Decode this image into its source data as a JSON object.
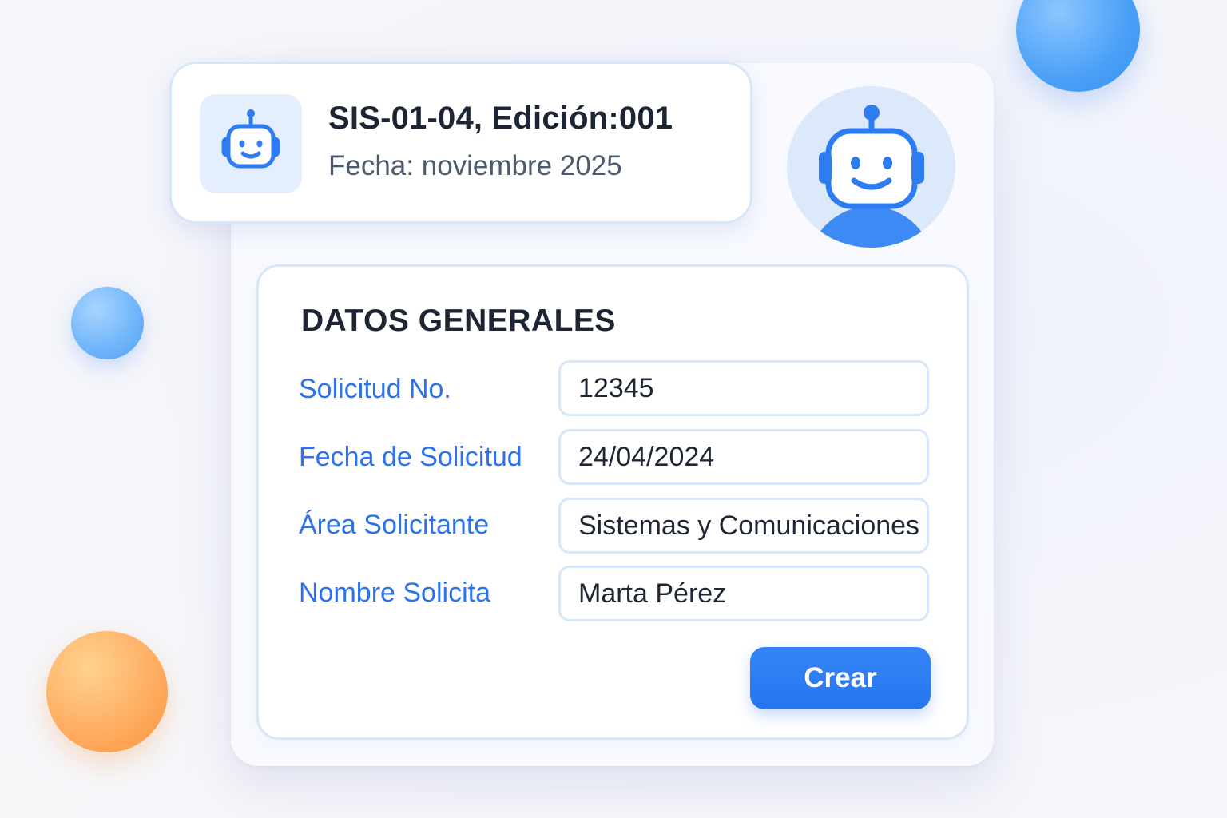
{
  "header": {
    "title": "SIS-01-04, Edición:001",
    "date": "Fecha: noviembre 2025",
    "icon": "robot-icon"
  },
  "avatar": {
    "icon": "robot-avatar-icon"
  },
  "form": {
    "title": "DATOS GENERALES",
    "fields": [
      {
        "label": "Solicitud No.",
        "value": "12345"
      },
      {
        "label": "Fecha de Solicitud",
        "value": "24/04/2024"
      },
      {
        "label": "Área Solicitante",
        "value": "Sistemas y Comunicaciones"
      },
      {
        "label": "Nombre Solicita",
        "value": "Marta Pérez"
      }
    ],
    "submit_label": "Crear"
  },
  "colors": {
    "accent": "#2b73ee",
    "button": "#2f7ef5",
    "text_dark": "#1d2535",
    "border": "#d6e6fb",
    "decor_blue": "#4aa0f7",
    "decor_orange": "#ffab5e"
  }
}
